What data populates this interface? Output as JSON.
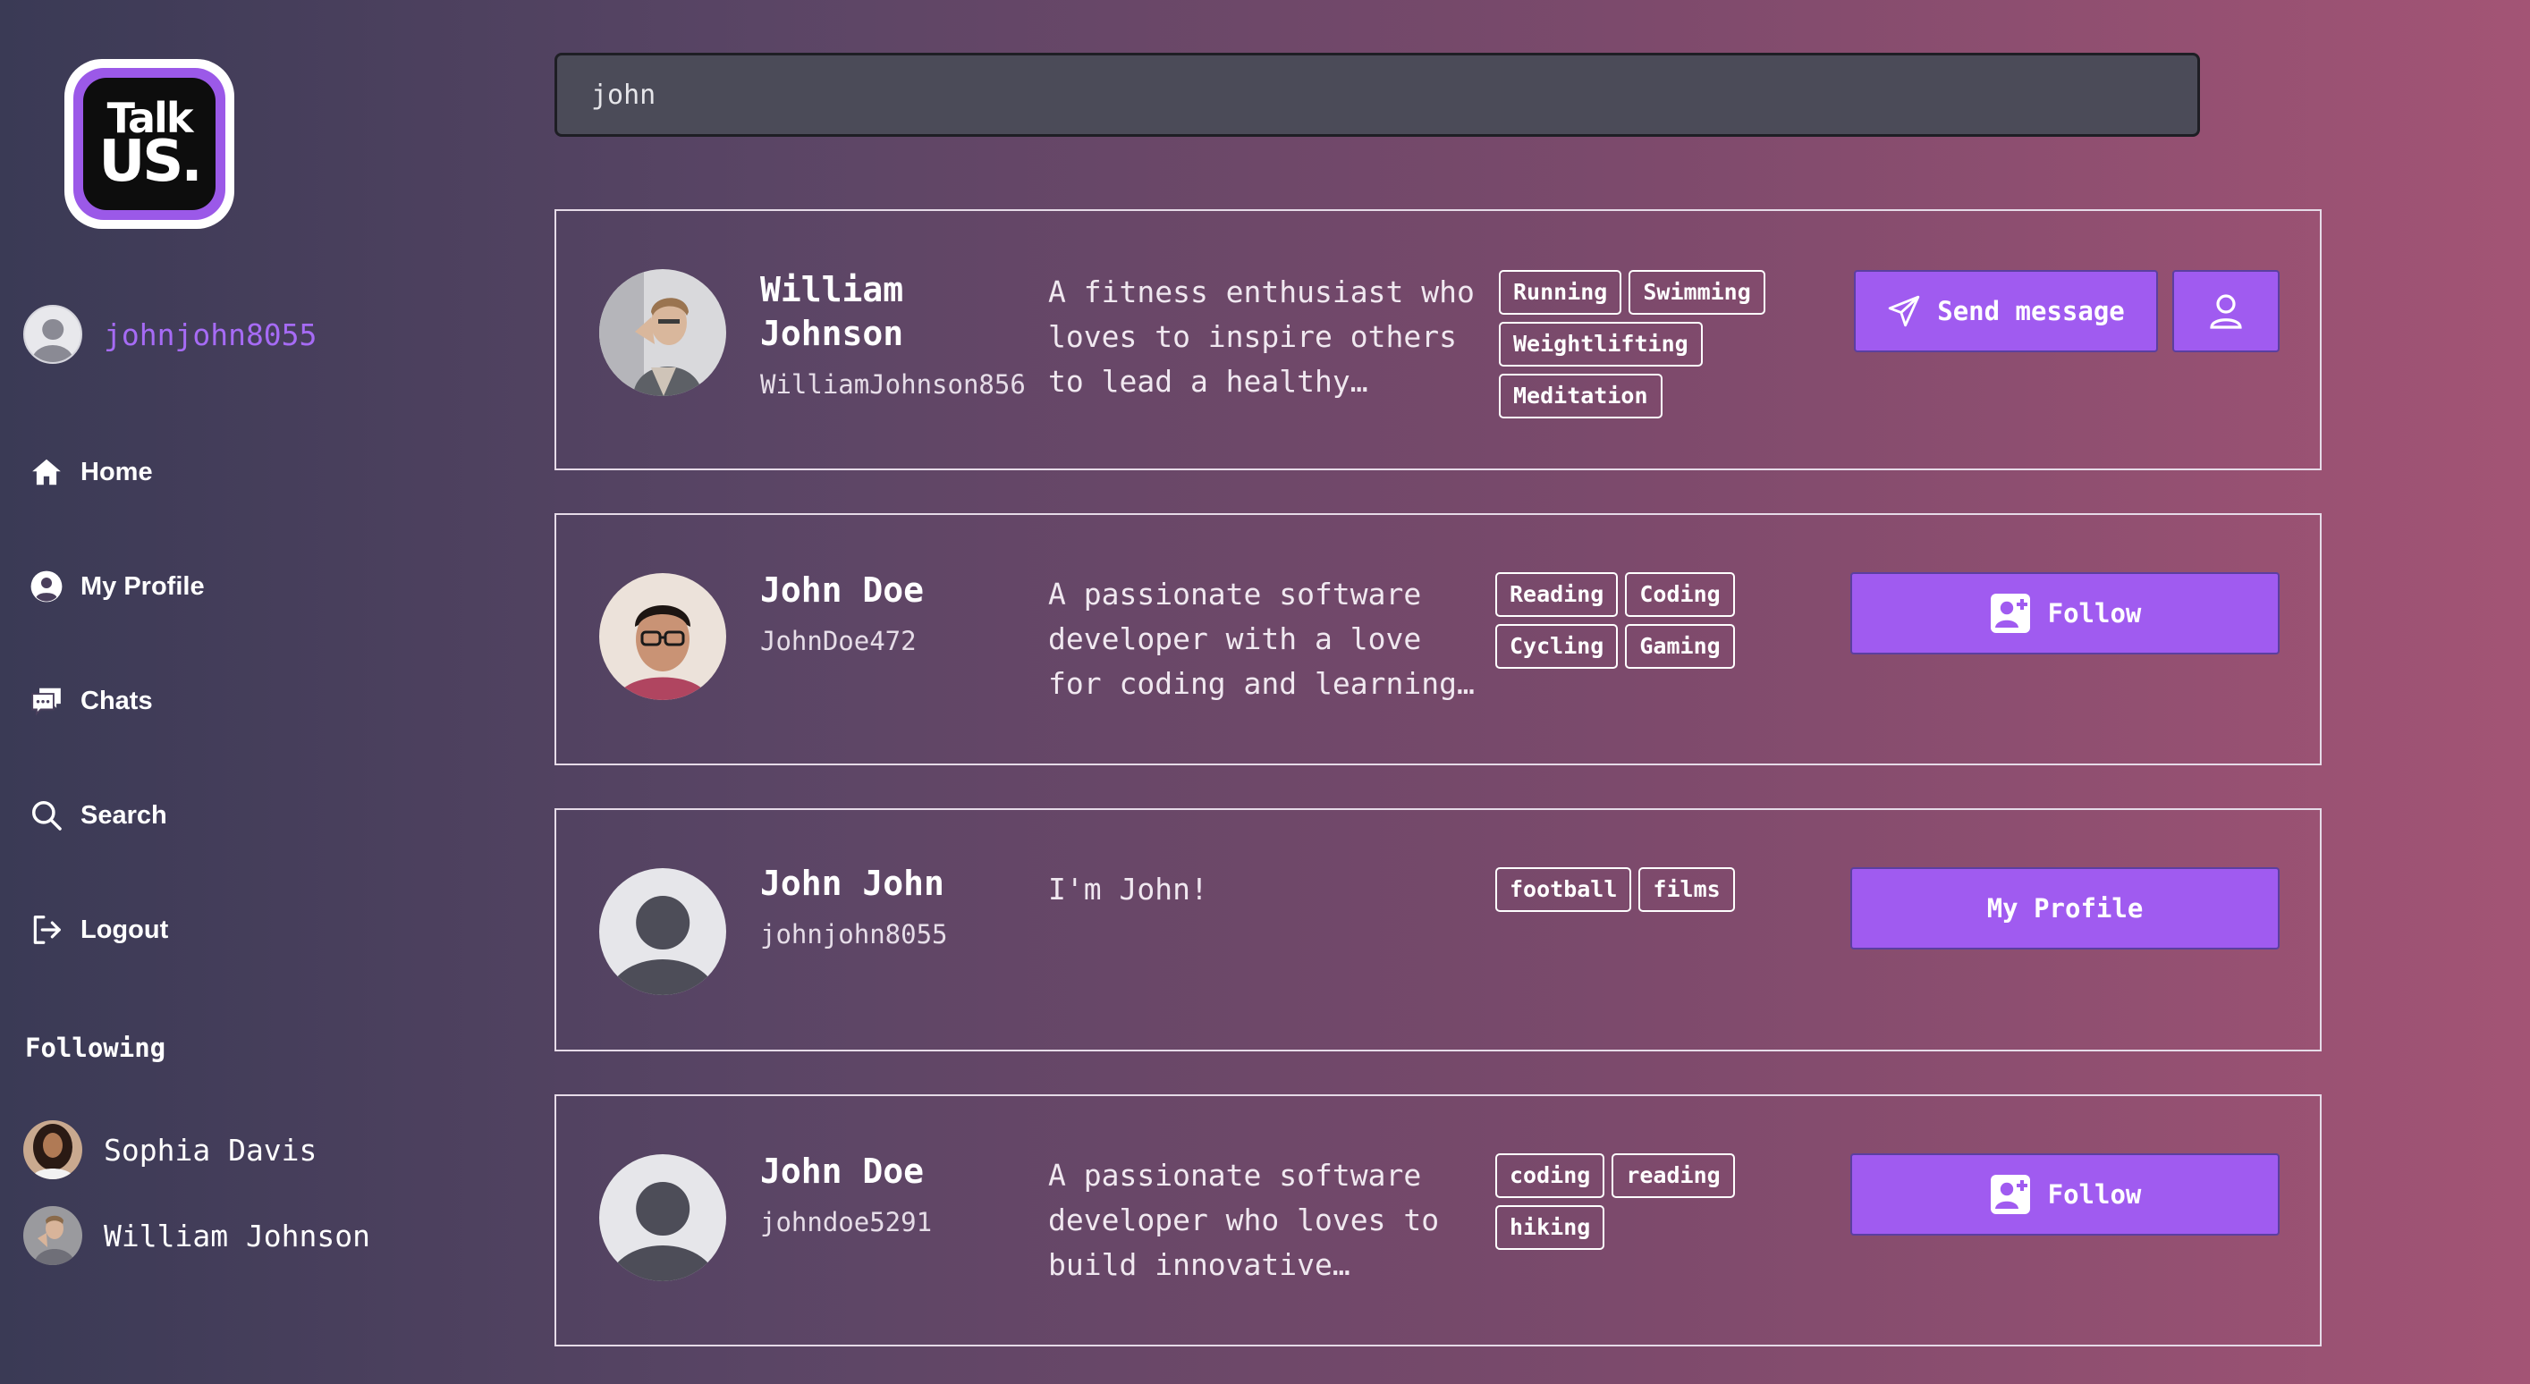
{
  "app": {
    "logo_line1": "Talk",
    "logo_line2": "US."
  },
  "current_user": {
    "username": "johnjohn8055"
  },
  "nav": {
    "home": "Home",
    "profile": "My Profile",
    "chats": "Chats",
    "search": "Search",
    "logout": "Logout"
  },
  "following": {
    "title": "Following",
    "users": [
      {
        "name": "Sophia Davis"
      },
      {
        "name": "William Johnson"
      }
    ]
  },
  "search": {
    "value": "john"
  },
  "results": [
    {
      "name": "William Johnson",
      "username": "WilliamJohnson856",
      "bio": "A fitness enthusiast who loves to inspire others to lead a healthy…",
      "tags": [
        "Running",
        "Swimming",
        "Weightlifting",
        "Meditation"
      ],
      "action_label": "Send message"
    },
    {
      "name": "John Doe",
      "username": "JohnDoe472",
      "bio": "A passionate software developer with a love for coding and learning…",
      "tags": [
        "Reading",
        "Coding",
        "Cycling",
        "Gaming"
      ],
      "action_label": "Follow"
    },
    {
      "name": "John John",
      "username": "johnjohn8055",
      "bio": "I'm John!",
      "tags": [
        "football",
        "films"
      ],
      "action_label": "My Profile"
    },
    {
      "name": "John Doe",
      "username": "johndoe5291",
      "bio": "A passionate software developer who loves to build innovative…",
      "tags": [
        "coding",
        "reading",
        "hiking"
      ],
      "action_label": "Follow"
    }
  ],
  "colors": {
    "accent": "#a05bf0",
    "username_accent": "#a66bf5",
    "search_bg": "#4b4b58"
  }
}
